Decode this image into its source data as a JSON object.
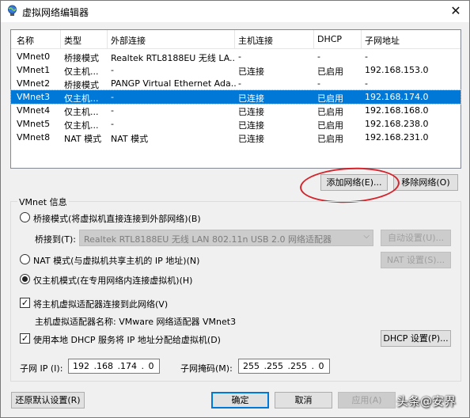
{
  "window": {
    "title": "虚拟网络编辑器",
    "close": "✕"
  },
  "table": {
    "headers": [
      "名称",
      "类型",
      "外部连接",
      "主机连接",
      "DHCP",
      "子网地址"
    ],
    "rows": [
      [
        "VMnet0",
        "桥接模式",
        "Realtek RTL8188EU 无线 LA...",
        "-",
        "-",
        "-"
      ],
      [
        "VMnet1",
        "仅主机...",
        "-",
        "已连接",
        "已启用",
        "192.168.153.0"
      ],
      [
        "VMnet2",
        "桥接模式",
        "PANGP Virtual Ethernet Ada...",
        "-",
        "-",
        "-"
      ],
      [
        "VMnet3",
        "仅主机...",
        "-",
        "已连接",
        "已启用",
        "192.168.174.0"
      ],
      [
        "VMnet4",
        "仅主机...",
        "-",
        "已连接",
        "已启用",
        "192.168.168.0"
      ],
      [
        "VMnet5",
        "仅主机...",
        "-",
        "已连接",
        "已启用",
        "192.168.238.0"
      ],
      [
        "VMnet8",
        "NAT 模式",
        "NAT 模式",
        "已连接",
        "已启用",
        "192.168.231.0"
      ]
    ],
    "selected_index": 3
  },
  "buttons": {
    "add_network": "添加网络(E)...",
    "remove_network": "移除网络(O)",
    "auto_settings": "自动设置(U)...",
    "nat_settings": "NAT 设置(S)...",
    "dhcp_settings": "DHCP 设置(P)...",
    "restore_defaults": "还原默认设置(R)",
    "ok": "确定",
    "cancel": "取消",
    "apply": "应用(A)"
  },
  "vmnet_info": {
    "group_title": "VMnet 信息",
    "bridge_label": "桥接模式(将虚拟机直接连接到外部网络)(B)",
    "bridge_to_label": "桥接到(T):",
    "bridge_to_value": "Realtek RTL8188EU 无线 LAN 802.11n USB 2.0 网络适配器",
    "nat_label": "NAT 模式(与虚拟机共享主机的 IP 地址)(N)",
    "hostonly_label": "仅主机模式(在专用网络内连接虚拟机)(H)",
    "connect_adapter_label": "将主机虚拟适配器连接到此网络(V)",
    "adapter_name_label": "主机虚拟适配器名称: VMware 网络适配器 VMnet3",
    "dhcp_label": "使用本地 DHCP 服务将 IP 地址分配给虚拟机(D)",
    "subnet_ip_label": "子网 IP (I):",
    "subnet_ip_value": "192 .168 .174 . 0",
    "subnet_mask_label": "子网掩码(M):",
    "subnet_mask_value": "255 .255 .255 . 0"
  },
  "watermark": "头条@安界",
  "colors": {
    "selection": "#0078d7",
    "annotation_circle": "#d4232b"
  }
}
